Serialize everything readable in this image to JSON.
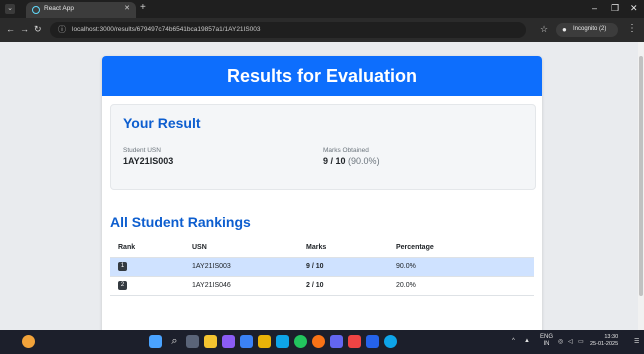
{
  "browser": {
    "tab_title": "React App",
    "url": "localhost:3000/results/679497c74b6541bca19857a1/1AY21IS003",
    "profile_label": "Incognito (2)"
  },
  "page": {
    "banner_title": "Results for Evaluation",
    "your_result": {
      "heading": "Your Result",
      "usn_label": "Student USN",
      "usn_value": "1AY21IS003",
      "marks_label": "Marks Obtained",
      "marks_value": "9 / 10",
      "marks_pct": "(90.0%)"
    },
    "rankings": {
      "heading": "All Student Rankings",
      "columns": [
        "Rank",
        "USN",
        "Marks",
        "Percentage"
      ],
      "rows": [
        {
          "rank": "1",
          "usn": "1AY21IS003",
          "marks": "9 / 10",
          "percentage": "90.0%"
        },
        {
          "rank": "2",
          "usn": "1AY21IS046",
          "marks": "2 / 10",
          "percentage": "20.0%"
        }
      ]
    }
  },
  "taskbar": {
    "lang_top": "ENG",
    "lang_bottom": "IN",
    "time": "13:30",
    "date": "25-01-2025"
  },
  "colors": {
    "accent": "#0d6efd",
    "heading": "#0d5ecf",
    "highlight_row": "#cfe2ff"
  }
}
